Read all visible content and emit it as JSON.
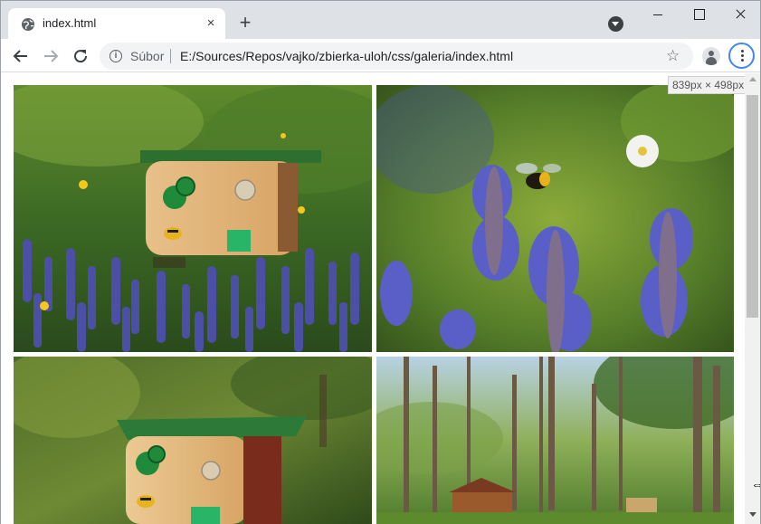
{
  "tab": {
    "title": "index.html",
    "close_glyph": "×",
    "new_tab_glyph": "+"
  },
  "toolbar": {
    "info_glyph": "i",
    "chip_label": "Súbor",
    "url": "E:/Sources/Repos/vajko/zbierka-uloh/css/galeria/index.html",
    "star_glyph": "☆"
  },
  "viewport": {
    "dimensions_tooltip": "839px × 498px"
  },
  "gallery": {
    "photos": [
      {
        "subject": "wooden bee house with green roof among blue bugle flowers"
      },
      {
        "subject": "bumblebee on blue bugle flowers"
      },
      {
        "subject": "wooden bee house with green roof, side view"
      },
      {
        "subject": "forest clearing with wooden gazebo"
      }
    ]
  },
  "colors": {
    "accent": "#4285f4",
    "tabstrip": "#dee1e6",
    "omnibox": "#f1f3f4"
  },
  "icons": [
    "globe-icon",
    "close-icon",
    "plus-icon",
    "tab-search-icon",
    "back-icon",
    "forward-icon",
    "reload-icon",
    "info-icon",
    "star-icon",
    "profile-icon",
    "menu-icon"
  ]
}
